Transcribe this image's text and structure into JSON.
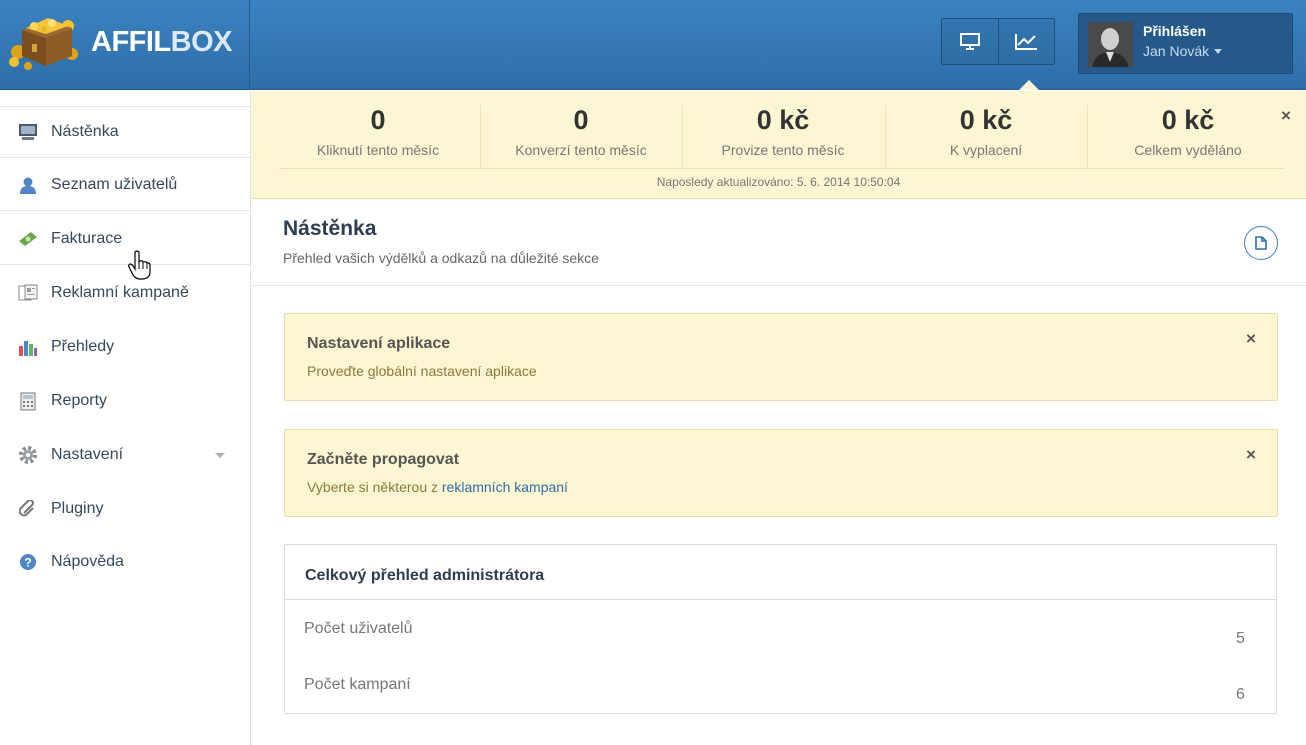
{
  "header": {
    "logo_text_1": "AFFIL",
    "logo_text_2": "BOX",
    "user": {
      "title": "Přihlášen",
      "name": "Jan Novák"
    }
  },
  "sidebar": {
    "items": [
      {
        "label": "Nástěnka",
        "icon": "monitor-icon"
      },
      {
        "label": "Seznam uživatelů",
        "icon": "user-icon"
      },
      {
        "label": "Fakturace",
        "icon": "money-icon"
      },
      {
        "label": "Reklamní kampaně",
        "icon": "campaign-icon"
      },
      {
        "label": "Přehledy",
        "icon": "bar-chart-icon"
      },
      {
        "label": "Reporty",
        "icon": "calculator-icon"
      },
      {
        "label": "Nastavení",
        "icon": "gear-icon"
      },
      {
        "label": "Pluginy",
        "icon": "paperclip-icon"
      },
      {
        "label": "Nápověda",
        "icon": "help-icon"
      }
    ]
  },
  "stats": {
    "items": [
      {
        "value": "0",
        "label": "Kliknutí tento měsíc"
      },
      {
        "value": "0",
        "label": "Konverzí tento měsíc"
      },
      {
        "value": "0 kč",
        "label": "Provize tento měsíc"
      },
      {
        "value": "0 kč",
        "label": "K vyplacení"
      },
      {
        "value": "0 kč",
        "label": "Celkem vyděláno"
      }
    ],
    "updated": "Naposledy aktualizováno: 5. 6. 2014 10:50:04",
    "close": "×"
  },
  "page": {
    "title": "Nástěnka",
    "subtitle": "Přehled vašich výdělků a odkazů na důležité sekce"
  },
  "alerts": [
    {
      "title": "Nastavení aplikace",
      "text": "Proveďte globální nastavení aplikace",
      "close": "×"
    },
    {
      "title": "Začněte propagovat",
      "text": "Vyberte si některou z ",
      "link": "reklamních kampaní",
      "close": "×"
    }
  ],
  "panel": {
    "title": "Celkový přehled administrátora",
    "rows": [
      {
        "label": "Počet uživatelů",
        "value": "5"
      },
      {
        "label": "Počet kampaní",
        "value": "6"
      }
    ]
  }
}
